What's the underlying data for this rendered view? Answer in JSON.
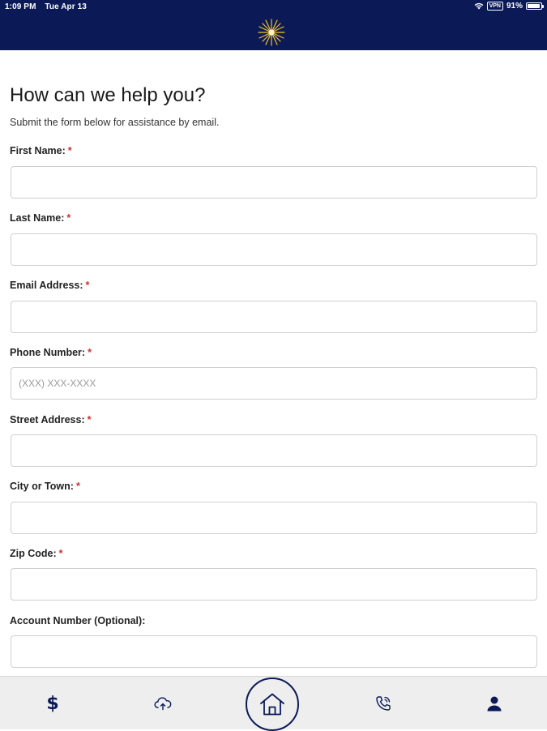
{
  "status_bar": {
    "time": "1:09 PM",
    "date": "Tue Apr 13",
    "vpn": "VPN",
    "battery_percent": "91%",
    "battery_level": 0.91
  },
  "header": {
    "logo_icon": "sunburst-logo-icon",
    "background_color": "#0b1a57",
    "accent_color": "#f5c518"
  },
  "form": {
    "title": "How can we help you?",
    "subtitle": "Submit the form below for assistance by email.",
    "required_marker": "*",
    "fields": [
      {
        "label": "First Name:",
        "required": true,
        "value": "",
        "placeholder": ""
      },
      {
        "label": "Last Name:",
        "required": true,
        "value": "",
        "placeholder": ""
      },
      {
        "label": "Email Address:",
        "required": true,
        "value": "",
        "placeholder": ""
      },
      {
        "label": "Phone Number:",
        "required": true,
        "value": "",
        "placeholder": "(XXX) XXX-XXXX"
      },
      {
        "label": "Street Address:",
        "required": true,
        "value": "",
        "placeholder": ""
      },
      {
        "label": "City or Town:",
        "required": true,
        "value": "",
        "placeholder": ""
      },
      {
        "label": "Zip Code:",
        "required": true,
        "value": "",
        "placeholder": ""
      },
      {
        "label": "Account Number (Optional):",
        "required": false,
        "value": "",
        "placeholder": ""
      }
    ]
  },
  "tab_bar": {
    "tabs": [
      {
        "icon": "dollar-icon",
        "glyph": "$"
      },
      {
        "icon": "cloud-upload-icon"
      },
      {
        "icon": "home-icon",
        "selected": true
      },
      {
        "icon": "phone-icon"
      },
      {
        "icon": "user-icon"
      }
    ]
  }
}
